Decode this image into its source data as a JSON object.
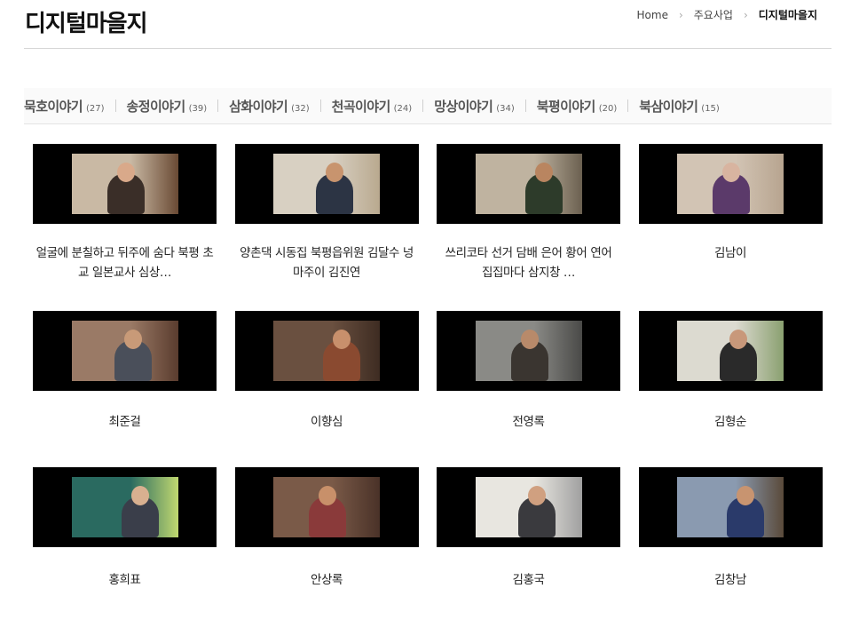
{
  "header": {
    "title": "디지털마을지",
    "breadcrumb": [
      {
        "label": "Home"
      },
      {
        "label": "주요사업"
      },
      {
        "label": "디지털마을지"
      }
    ]
  },
  "tabs": [
    {
      "label": "묵호이야기",
      "count": "(27)"
    },
    {
      "label": "송정이야기",
      "count": "(39)"
    },
    {
      "label": "삼화이야기",
      "count": "(32)"
    },
    {
      "label": "천곡이야기",
      "count": "(24)"
    },
    {
      "label": "망상이야기",
      "count": "(34)"
    },
    {
      "label": "북평이야기",
      "count": "(20)"
    },
    {
      "label": "북삼이야기",
      "count": "(15)"
    }
  ],
  "videos": [
    {
      "caption": "얼굴에 분칠하고 뒤주에 숨다 북평 초교 일본교사 심상…",
      "bg": "#c9b9a4",
      "wall": "#6a4a34",
      "figure": "#3a2e28",
      "face": "#d9a98a"
    },
    {
      "caption": "양촌댁 시동집 북평읍위원 김달수 넝마주이 김진연",
      "bg": "#d8d0c2",
      "wall": "#b9a98f",
      "figure": "#2c3444",
      "face": "#c8946e"
    },
    {
      "caption": "쓰리코타 선거 담배 은어 황어 연어 집집마다 삼지창 …",
      "bg": "#bfb3a0",
      "wall": "#6b6050",
      "figure": "#2d3b2a",
      "face": "#b98560"
    },
    {
      "caption": "김남이",
      "bg": "#d2c4b4",
      "wall": "#b7a48f",
      "figure": "#5b3a6a",
      "face": "#d8b4a0"
    },
    {
      "caption": "최준걸",
      "bg": "#9a7a66",
      "wall": "#5a3c2e",
      "figure": "#4a4f5a",
      "face": "#c89a78"
    },
    {
      "caption": "이향심",
      "bg": "#6a5040",
      "wall": "#3e2c22",
      "figure": "#8a4a30",
      "face": "#c8906c"
    },
    {
      "caption": "전영록",
      "bg": "#8a8a86",
      "wall": "#4a4a48",
      "figure": "#3a3530",
      "face": "#b88a6a"
    },
    {
      "caption": "김형순",
      "bg": "#dcdad0",
      "wall": "#8aa070",
      "figure": "#2a2a2a",
      "face": "#c8987a"
    },
    {
      "caption": "홍희표",
      "bg": "#2a6a60",
      "wall": "#c0d870",
      "figure": "#3a3e4a",
      "face": "#d8b090"
    },
    {
      "caption": "안상록",
      "bg": "#7a5a48",
      "wall": "#4a3228",
      "figure": "#8a3a3a",
      "face": "#c8906a"
    },
    {
      "caption": "김홍국",
      "bg": "#e8e6e0",
      "wall": "#a0a0a0",
      "figure": "#3a3a3e",
      "face": "#d0a080"
    },
    {
      "caption": "김창남",
      "bg": "#8a9ab0",
      "wall": "#5a4a3a",
      "figure": "#2a3a6a",
      "face": "#c89470"
    }
  ]
}
